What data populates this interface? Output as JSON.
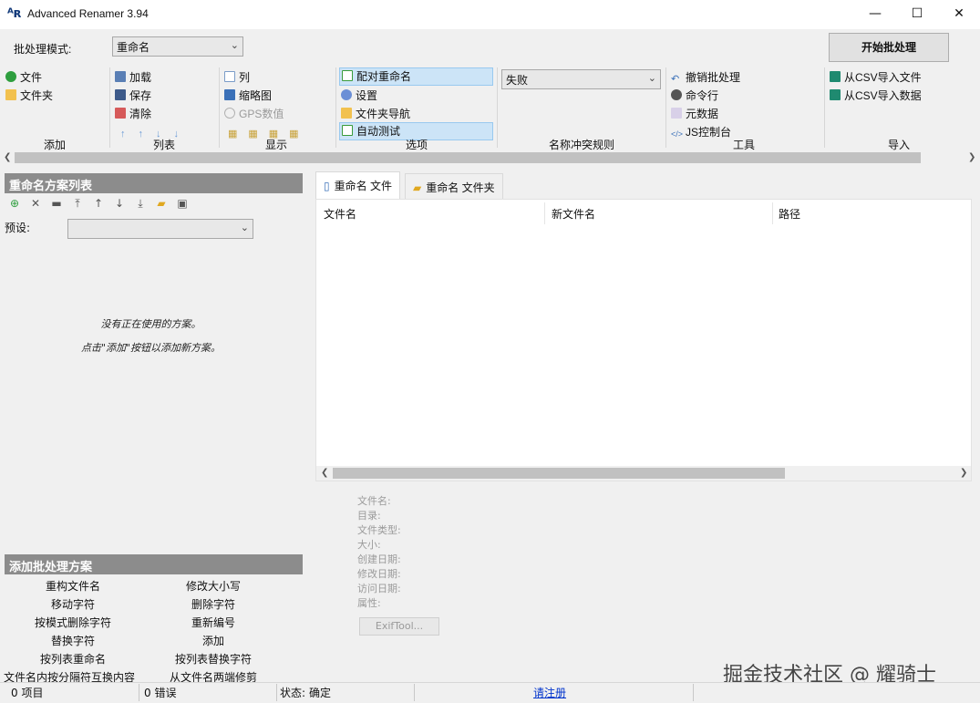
{
  "window": {
    "title": "Advanced Renamer 3.94",
    "app_icon": "AR"
  },
  "topbar": {
    "mode_label": "批处理模式:",
    "mode_value": "重命名",
    "start_button": "开始批处理"
  },
  "ribbon": {
    "add": {
      "items": [
        "文件",
        "文件夹"
      ],
      "label": "添加"
    },
    "list": {
      "items": [
        "加载",
        "保存",
        "清除"
      ],
      "label": "列表"
    },
    "display": {
      "items": [
        "列",
        "缩略图",
        "GPS数值"
      ],
      "label": "显示"
    },
    "options": {
      "items": [
        "配对重命名",
        "设置",
        "文件夹导航",
        "自动测试"
      ],
      "label": "选项"
    },
    "conflict": {
      "value": "失败",
      "label": "名称冲突规则"
    },
    "tools": {
      "items": [
        "撤销批处理",
        "命令行",
        "元数据",
        "JS控制台"
      ],
      "label": "工具"
    },
    "import": {
      "items": [
        "从CSV导入文件",
        "从CSV导入数据"
      ],
      "label": "导入"
    }
  },
  "methods_panel": {
    "header": "重命名方案列表",
    "preset_label": "预设:",
    "empty_line1": "没有正在使用的方案。",
    "empty_line2": "点击\"添加\"按钮以添加新方案。"
  },
  "tabs": [
    {
      "label": "重命名 文件"
    },
    {
      "label": "重命名 文件夹"
    }
  ],
  "file_list": {
    "columns": [
      "文件名",
      "新文件名",
      "路径"
    ]
  },
  "file_info": {
    "labels": [
      "文件名:",
      "目录:",
      "文件类型:",
      "大小:",
      "创建日期:",
      "修改日期:",
      "访问日期:",
      "属性:"
    ],
    "exif_button": "ExifTool..."
  },
  "add_panel": {
    "header": "添加批处理方案",
    "methods": [
      "重构文件名",
      "修改大小写",
      "移动字符",
      "删除字符",
      "按模式删除字符",
      "重新编号",
      "替换字符",
      "添加",
      "按列表重命名",
      "按列表替换字符",
      "文件名内按分隔符互换内容",
      "从文件名两端修剪"
    ]
  },
  "statusbar": {
    "items": "0 项目",
    "errors": "0 错误",
    "status_label": "状态:",
    "status_value": "确定",
    "register": "请注册"
  },
  "watermark": "掘金技术社区 @ 耀骑士",
  "colors": {
    "panel_header": "#8c8c8c",
    "highlight": "#cce4f7",
    "link": "#0033cc"
  }
}
